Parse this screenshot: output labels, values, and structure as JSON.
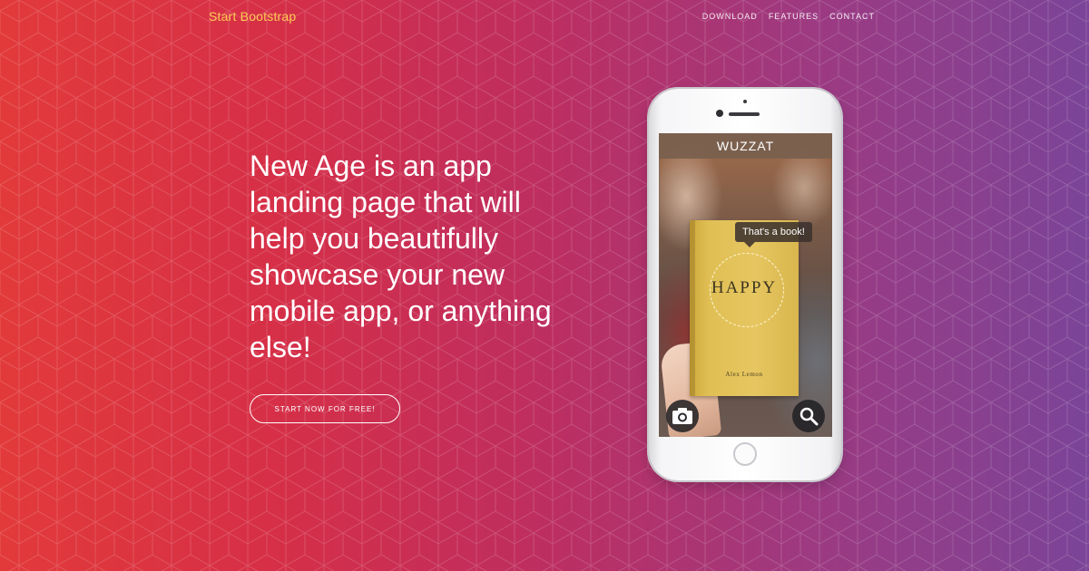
{
  "navbar": {
    "brand": "Start Bootstrap",
    "links": [
      "Download",
      "Features",
      "Contact"
    ]
  },
  "hero": {
    "headline": "New Age is an app landing page that will help you beautifully showcase your new mobile app, or anything else!",
    "cta_label": "Start Now for Free!"
  },
  "phone_screen": {
    "app_title": "WUZZAT",
    "bubble_text": "That's a book!",
    "book_title": "HAPPY",
    "book_author": "Alex Lemon",
    "left_button_icon": "camera-icon",
    "right_button_icon": "search-icon"
  },
  "colors": {
    "brand": "#fdcc52",
    "gradient_start": "#e23a3a",
    "gradient_end": "#7b4498"
  }
}
